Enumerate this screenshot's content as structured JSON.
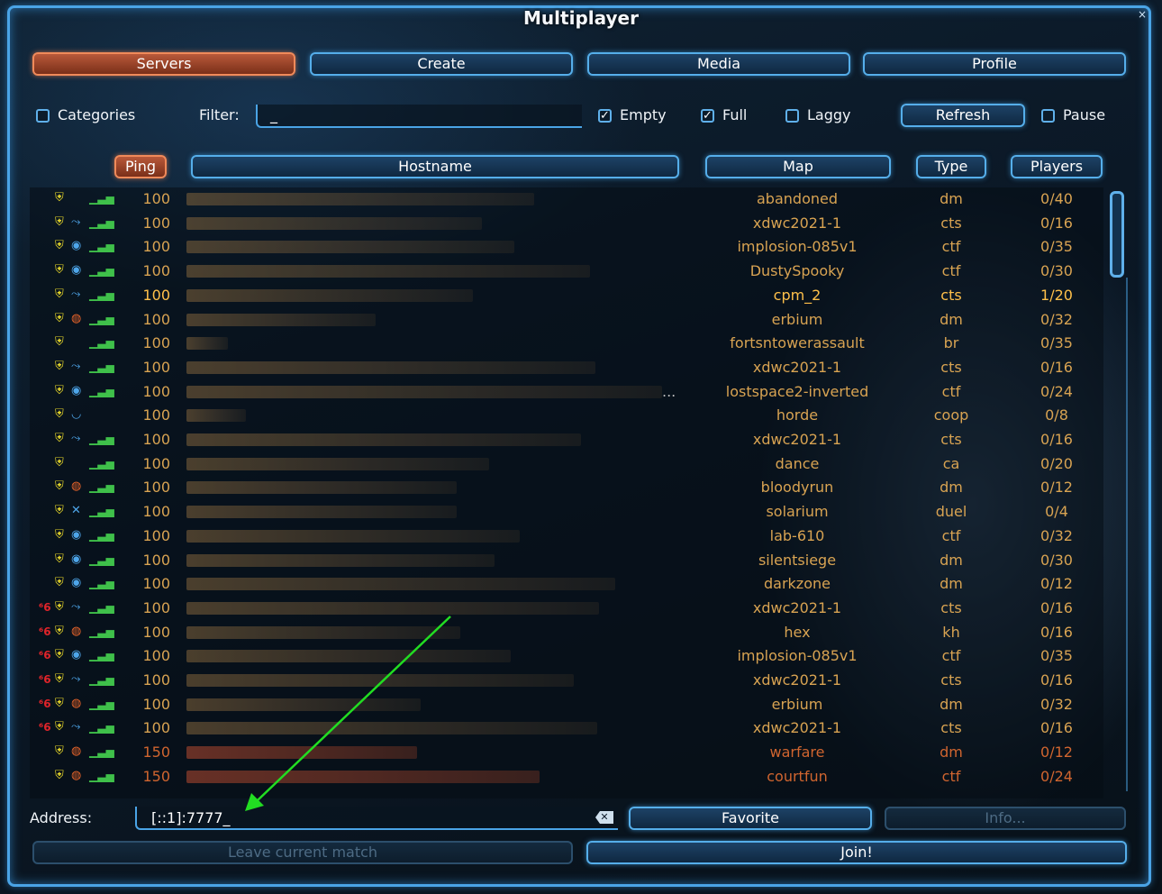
{
  "window": {
    "title": "Multiplayer",
    "close_label": "×"
  },
  "tabs": [
    {
      "label": "Servers",
      "active": true
    },
    {
      "label": "Create",
      "active": false
    },
    {
      "label": "Media",
      "active": false
    },
    {
      "label": "Profile",
      "active": false
    }
  ],
  "filters": {
    "categories_label": "Categories",
    "categories_checked": false,
    "filter_label": "Filter:",
    "filter_value": "_",
    "empty_label": "Empty",
    "empty_checked": true,
    "full_label": "Full",
    "full_checked": true,
    "laggy_label": "Laggy",
    "laggy_checked": false,
    "refresh_label": "Refresh",
    "pause_label": "Pause",
    "pause_checked": false
  },
  "columns": {
    "ping": "Ping",
    "hostname": "Hostname",
    "map": "Map",
    "type": "Type",
    "players": "Players"
  },
  "servers": [
    {
      "v6": false,
      "mode": "none",
      "ping": "100",
      "map": "abandoned",
      "type": "dm",
      "players": "0/40"
    },
    {
      "v6": false,
      "mode": "arrow",
      "ping": "100",
      "map": "xdwc2021-1",
      "type": "cts",
      "players": "0/16"
    },
    {
      "v6": false,
      "mode": "target",
      "ping": "100",
      "map": "implosion-085v1",
      "type": "ctf",
      "players": "0/35"
    },
    {
      "v6": false,
      "mode": "target",
      "ping": "100",
      "map": "DustySpooky",
      "type": "ctf",
      "players": "0/30"
    },
    {
      "v6": false,
      "mode": "arrow",
      "ping": "100",
      "map": "cpm_2",
      "type": "cts",
      "players": "1/20",
      "highlight": true
    },
    {
      "v6": false,
      "mode": "fire",
      "ping": "100",
      "map": "erbium",
      "type": "dm",
      "players": "0/32"
    },
    {
      "v6": false,
      "mode": "none",
      "ping": "100",
      "map": "fortsntowerassault",
      "type": "br",
      "players": "0/35"
    },
    {
      "v6": false,
      "mode": "arrow",
      "ping": "100",
      "map": "xdwc2021-1",
      "type": "cts",
      "players": "0/16"
    },
    {
      "v6": false,
      "mode": "target",
      "ping": "100",
      "map": "lostspace2-inverted",
      "type": "ctf",
      "players": "0/24",
      "ellipsis": "..."
    },
    {
      "v6": false,
      "mode": "horde",
      "ping": "100",
      "map": "horde",
      "type": "coop",
      "players": "0/8"
    },
    {
      "v6": false,
      "mode": "arrow",
      "ping": "100",
      "map": "xdwc2021-1",
      "type": "cts",
      "players": "0/16"
    },
    {
      "v6": false,
      "mode": "none",
      "ping": "100",
      "map": "dance",
      "type": "ca",
      "players": "0/20"
    },
    {
      "v6": false,
      "mode": "fire",
      "ping": "100",
      "map": "bloodyrun",
      "type": "dm",
      "players": "0/12"
    },
    {
      "v6": false,
      "mode": "cross",
      "ping": "100",
      "map": "solarium",
      "type": "duel",
      "players": "0/4"
    },
    {
      "v6": false,
      "mode": "target",
      "ping": "100",
      "map": "lab-610",
      "type": "ctf",
      "players": "0/32"
    },
    {
      "v6": false,
      "mode": "target",
      "ping": "100",
      "map": "silentsiege",
      "type": "dm",
      "players": "0/30"
    },
    {
      "v6": false,
      "mode": "target",
      "ping": "100",
      "map": "darkzone",
      "type": "dm",
      "players": "0/12"
    },
    {
      "v6": true,
      "mode": "arrow",
      "ping": "100",
      "map": "xdwc2021-1",
      "type": "cts",
      "players": "0/16"
    },
    {
      "v6": true,
      "mode": "fire",
      "ping": "100",
      "map": "hex",
      "type": "kh",
      "players": "0/16"
    },
    {
      "v6": true,
      "mode": "target",
      "ping": "100",
      "map": "implosion-085v1",
      "type": "ctf",
      "players": "0/35"
    },
    {
      "v6": true,
      "mode": "arrow",
      "ping": "100",
      "map": "xdwc2021-1",
      "type": "cts",
      "players": "0/16"
    },
    {
      "v6": true,
      "mode": "fire",
      "ping": "100",
      "map": "erbium",
      "type": "dm",
      "players": "0/32"
    },
    {
      "v6": true,
      "mode": "arrow",
      "ping": "100",
      "map": "xdwc2021-1",
      "type": "cts",
      "players": "0/16"
    },
    {
      "v6": false,
      "mode": "fire",
      "ping": "150",
      "map": "warfare",
      "type": "dm",
      "players": "0/12",
      "far": true
    },
    {
      "v6": false,
      "mode": "fire",
      "ping": "150",
      "map": "courtfun",
      "type": "ctf",
      "players": "0/24",
      "far": true
    }
  ],
  "icons": {
    "v6": "ipv6-icon",
    "shield": "shield-icon",
    "signal": "signal-bars-icon"
  },
  "address": {
    "label": "Address:",
    "value": "[::1]:7777_"
  },
  "buttons": {
    "favorite": "Favorite",
    "info": "Info...",
    "leave": "Leave current match",
    "join": "Join!"
  },
  "colors": {
    "accent": "#4aa4e6",
    "active_tab": "#b9593a",
    "server_text": "#d8a352",
    "highlight_text": "#ffc04a",
    "far_text": "#d0652f",
    "arrow": "#22dd22"
  }
}
